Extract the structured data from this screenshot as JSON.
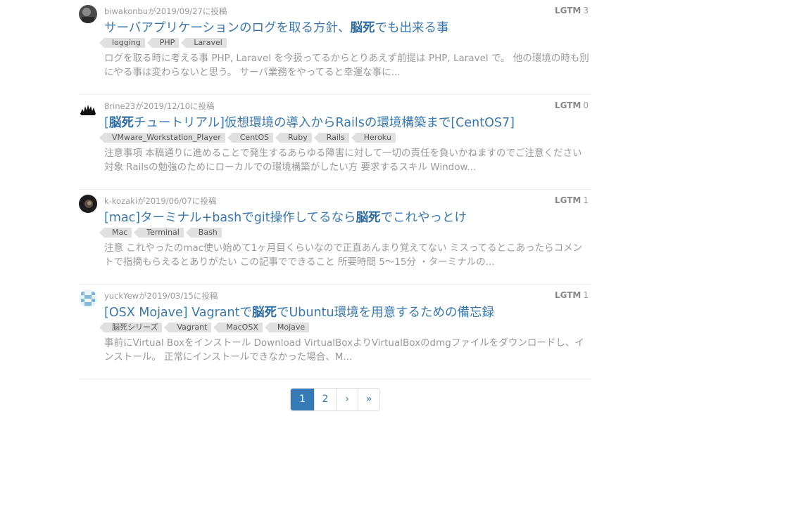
{
  "posts": [
    {
      "author_meta": "biwakonbuが2019/09/27に投稿",
      "lgtm_label": "LGTM",
      "lgtm_count": "3",
      "title_pre": "サーバアプリケーションのログを取る方針、",
      "title_hl": "脳死",
      "title_post": "でも出来る事",
      "tags": [
        "logging",
        "PHP",
        "Laravel"
      ],
      "excerpt": "ログを取る時に考える事 PHP, Laravel を今扱ってるからとりあえず前提は PHP, Laravel で。 他の環境の時も別にやる事は変わらないと思う。 サーバ業務をやってると幸運な事に..."
    },
    {
      "author_meta": "8rine23が2019/12/10に投稿",
      "lgtm_label": "LGTM",
      "lgtm_count": "0",
      "title_pre": "[",
      "title_hl": "脳死",
      "title_post": "チュートリアル]仮想環境の導入からRailsの環境構築まで[CentOS7]",
      "tags": [
        "VMware_Workstation_Player",
        "CentOS",
        "Ruby",
        "Rails",
        "Heroku"
      ],
      "excerpt": "注意事項 本稿通りに進めることで発生するあらゆる障害に対して一切の責任を負いかねますのでご注意ください 対象 Railsの勉強のためにローカルでの環境構築がしたい方 要求するスキル Window..."
    },
    {
      "author_meta": "k-kozakiが2019/06/07に投稿",
      "lgtm_label": "LGTM",
      "lgtm_count": "1",
      "title_pre": "[mac]ターミナル+bashでgit操作してるなら",
      "title_hl": "脳死",
      "title_post": "でこれやっとけ",
      "tags": [
        "Mac",
        "Terminal",
        "Bash"
      ],
      "excerpt": "注意 これやったのmac使い始めて1ヶ月目くらいなので正直あんまり覚えてない ミスってるとこあったらコメントで指摘もらえるとありがたい この記事でできること 所要時間 5〜15分 ・ターミナルの..."
    },
    {
      "author_meta": "yuckYewが2019/03/15に投稿",
      "lgtm_label": "LGTM",
      "lgtm_count": "1",
      "title_pre": "[OSX Mojave] Vagrantで",
      "title_hl": "脳死",
      "title_post": "でUbuntu環境を用意するための備忘録",
      "tags": [
        "脳死シリーズ",
        "Vagrant",
        "MacOSX",
        "Mojave"
      ],
      "excerpt": "事前にVirtual Boxをインストール Download VirtualBoxよりVirtualBoxのdmgファイルをダウンロードし、インストール。 正常にインストールできなかった場合、M..."
    }
  ],
  "pagination": {
    "pages": [
      "1",
      "2",
      "›",
      "»"
    ],
    "active": "1"
  },
  "colors": {
    "link": "#3a77ad",
    "active_page": "#337ab7",
    "muted": "#999999"
  }
}
